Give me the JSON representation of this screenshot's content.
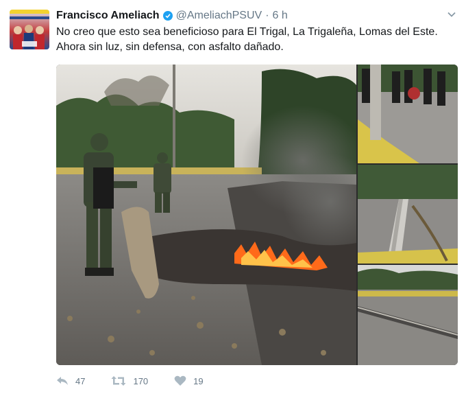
{
  "tweet": {
    "author_name": "Francisco Ameliach",
    "handle": "@AmeliachPSUV",
    "separator": "·",
    "time": "6 h",
    "text_line1": "No creo que esto sea beneficioso para El Trigal, La Trigaleña, Lomas del Este.",
    "text_line2": "Ahora sin luz, sin defensa, con asfalto dañado."
  },
  "actions": {
    "reply_count": "47",
    "retweet_count": "170",
    "like_count": "19"
  },
  "icons": {
    "verified": "verified-badge-icon",
    "menu": "chevron-down-icon",
    "reply": "reply-icon",
    "retweet": "retweet-icon",
    "like": "heart-icon"
  },
  "colors": {
    "verified": "#1da1f2",
    "secondary_text": "#657786",
    "action_icon": "#aab8c2",
    "fire": "#ff6a1a"
  }
}
